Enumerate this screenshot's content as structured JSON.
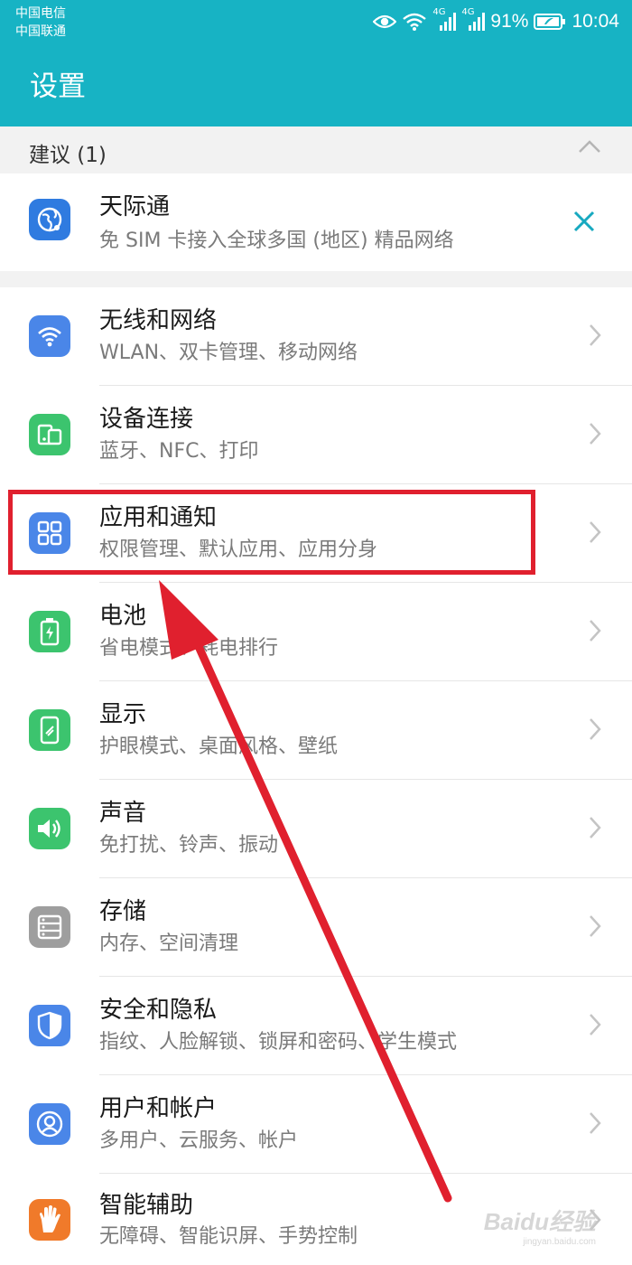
{
  "status_bar": {
    "carrier_1": "中国电信",
    "carrier_2": "中国联通",
    "network_1": "4G",
    "network_2": "4G",
    "battery_percent": "91%",
    "time": "10:04"
  },
  "header": {
    "title": "设置"
  },
  "suggestions": {
    "header_label": "建议 (1)",
    "item": {
      "title": "天际通",
      "subtitle": "免 SIM 卡接入全球多国 (地区) 精品网络",
      "icon": "globe-icon"
    }
  },
  "settings": [
    {
      "title": "无线和网络",
      "subtitle": "WLAN、双卡管理、移动网络",
      "icon": "wifi-icon",
      "color": "#4a86e8"
    },
    {
      "title": "设备连接",
      "subtitle": "蓝牙、NFC、打印",
      "icon": "device-connect-icon",
      "color": "#3cc46e"
    },
    {
      "title": "应用和通知",
      "subtitle": "权限管理、默认应用、应用分身",
      "icon": "apps-grid-icon",
      "color": "#4a86e8"
    },
    {
      "title": "电池",
      "subtitle": "省电模式、耗电排行",
      "icon": "battery-icon",
      "color": "#3cc46e"
    },
    {
      "title": "显示",
      "subtitle": "护眼模式、桌面风格、壁纸",
      "icon": "display-icon",
      "color": "#3cc46e"
    },
    {
      "title": "声音",
      "subtitle": "免打扰、铃声、振动",
      "icon": "speaker-icon",
      "color": "#3cc46e"
    },
    {
      "title": "存储",
      "subtitle": "内存、空间清理",
      "icon": "storage-icon",
      "color": "#9e9e9e"
    },
    {
      "title": "安全和隐私",
      "subtitle": "指纹、人脸解锁、锁屏和密码、学生模式",
      "icon": "shield-icon",
      "color": "#4a86e8"
    },
    {
      "title": "用户和帐户",
      "subtitle": "多用户、云服务、帐户",
      "icon": "user-icon",
      "color": "#4a86e8"
    },
    {
      "title": "智能辅助",
      "subtitle": "无障碍、智能识屏、手势控制",
      "icon": "hand-icon",
      "color": "#f07a2a"
    }
  ],
  "annotation": {
    "highlight_color": "#e0202e"
  },
  "watermark": {
    "text": "Baidu经验",
    "url": "jingyan.baidu.com"
  }
}
